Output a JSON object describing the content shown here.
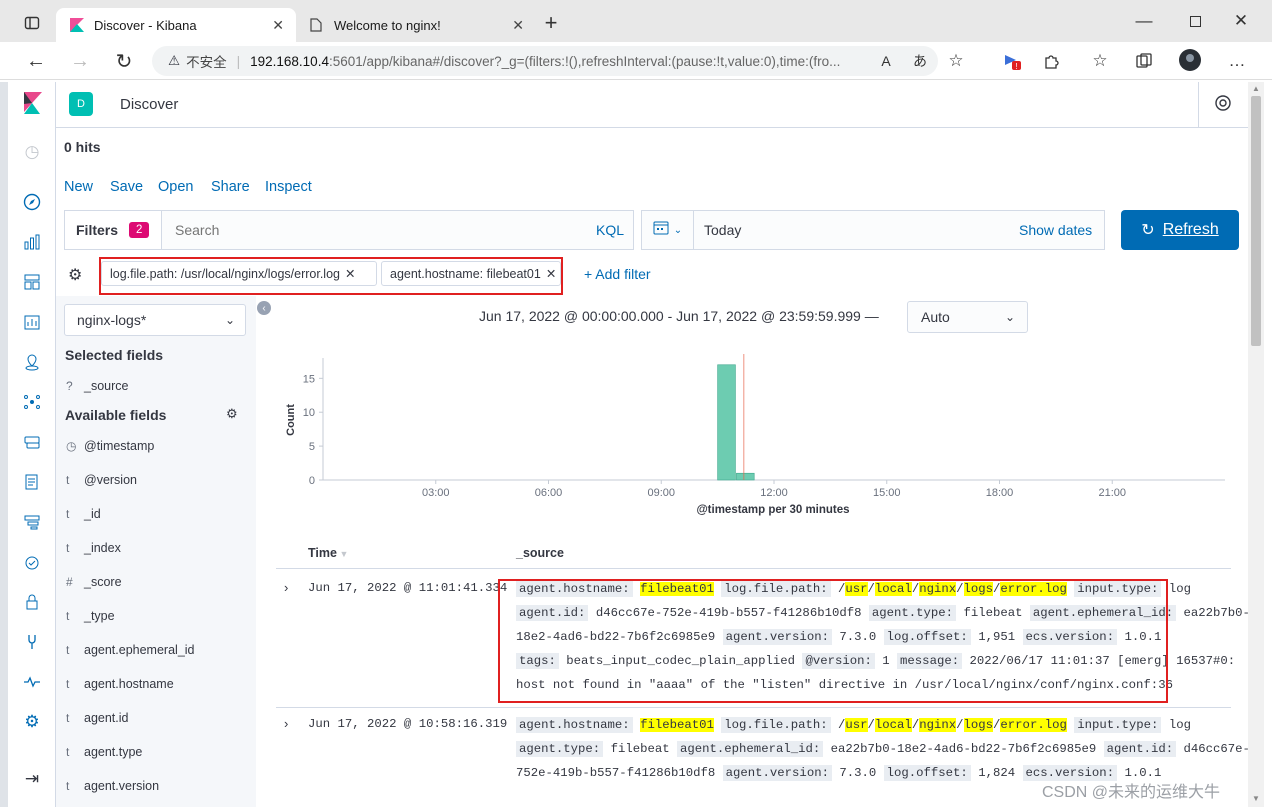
{
  "browser": {
    "tabs": [
      {
        "title": "Discover - Kibana"
      },
      {
        "title": "Welcome to nginx!"
      }
    ],
    "security_label": "不安全",
    "url_host": "192.168.10.4",
    "url_rest": ":5601/app/kibana#/discover?_g=(filters:!(),refreshInterval:(pause:!t,value:0),time:(fro..."
  },
  "kibana": {
    "space_letter": "D",
    "app_title": "Discover",
    "hits": "0 hits",
    "top_nav": [
      "New",
      "Save",
      "Open",
      "Share",
      "Inspect"
    ],
    "filters_label": "Filters",
    "filters_count": "2",
    "search_placeholder": "Search",
    "kql": "KQL",
    "date_value": "Today",
    "show_dates": "Show dates",
    "refresh": "Refresh",
    "pills": [
      "log.file.path: /usr/local/nginx/logs/error.log",
      "agent.hostname: filebeat01"
    ],
    "add_filter": "+ Add filter",
    "index_pattern": "nginx-logs*",
    "selected_fields_title": "Selected fields",
    "selected_fields": [
      {
        "type": "?",
        "name": "_source"
      }
    ],
    "available_fields_title": "Available fields",
    "available_fields": [
      {
        "type": "◷",
        "name": "@timestamp"
      },
      {
        "type": "t",
        "name": "@version"
      },
      {
        "type": "t",
        "name": "_id"
      },
      {
        "type": "t",
        "name": "_index"
      },
      {
        "type": "#",
        "name": "_score"
      },
      {
        "type": "t",
        "name": "_type"
      },
      {
        "type": "t",
        "name": "agent.ephemeral_id"
      },
      {
        "type": "t",
        "name": "agent.hostname"
      },
      {
        "type": "t",
        "name": "agent.id"
      },
      {
        "type": "t",
        "name": "agent.type"
      },
      {
        "type": "t",
        "name": "agent.version"
      }
    ],
    "time_range": "Jun 17, 2022 @ 00:00:00.000 - Jun 17, 2022 @ 23:59:59.999 —",
    "interval": "Auto",
    "col_time": "Time",
    "col_source": "_source",
    "watermark": "CSDN @未来的运维大牛",
    "docs": [
      {
        "time": "Jun 17, 2022 @ 11:01:41.334",
        "lines": [
          "agent.hostname: |filebeat01| log.file.path: /usr/local/nginx/logs/error.log input.type: log",
          "agent.id: d46cc67e-752e-419b-b557-f41286b10df8 agent.type: filebeat agent.ephemeral_id: ea22b7b0-",
          "18e2-4ad6-bd22-7b6f2c6985e9 agent.version: 7.3.0 log.offset: 1,951 ecs.version: 1.0.1",
          "tags: beats_input_codec_plain_applied @version: 1 message: 2022/06/17 11:01:37 [emerg] 16537#0:",
          "host not found in \"aaaa\" of the \"listen\" directive in /usr/local/nginx/conf/nginx.conf:36"
        ]
      },
      {
        "time": "Jun 17, 2022 @ 10:58:16.319",
        "lines": [
          "agent.hostname: |filebeat01| log.file.path: /usr/local/nginx/logs/error.log input.type: log",
          "agent.type: filebeat agent.ephemeral_id: ea22b7b0-18e2-4ad6-bd22-7b6f2c6985e9 agent.id: d46cc67e-",
          "752e-419b-b557-f41286b10df8 agent.version: 7.3.0 log.offset: 1,824 ecs.version: 1.0.1"
        ]
      }
    ]
  },
  "colors": {
    "accent": "#006bb4",
    "bar": "#6dccb1",
    "highlight": "#ffff00",
    "filter_badge": "#dd0a73",
    "annotation": "#e02020"
  },
  "chart_data": {
    "type": "bar",
    "title": "",
    "xlabel": "@timestamp per 30 minutes",
    "ylabel": "Count",
    "x_ticks": [
      "03:00",
      "06:00",
      "09:00",
      "12:00",
      "15:00",
      "18:00",
      "21:00"
    ],
    "y_ticks": [
      0,
      5,
      10,
      15
    ],
    "ylim": [
      0,
      18
    ],
    "bars": [
      {
        "x": "10:30",
        "value": 17
      },
      {
        "x": "11:00",
        "value": 1
      }
    ],
    "current_time_marker": "11:15"
  }
}
